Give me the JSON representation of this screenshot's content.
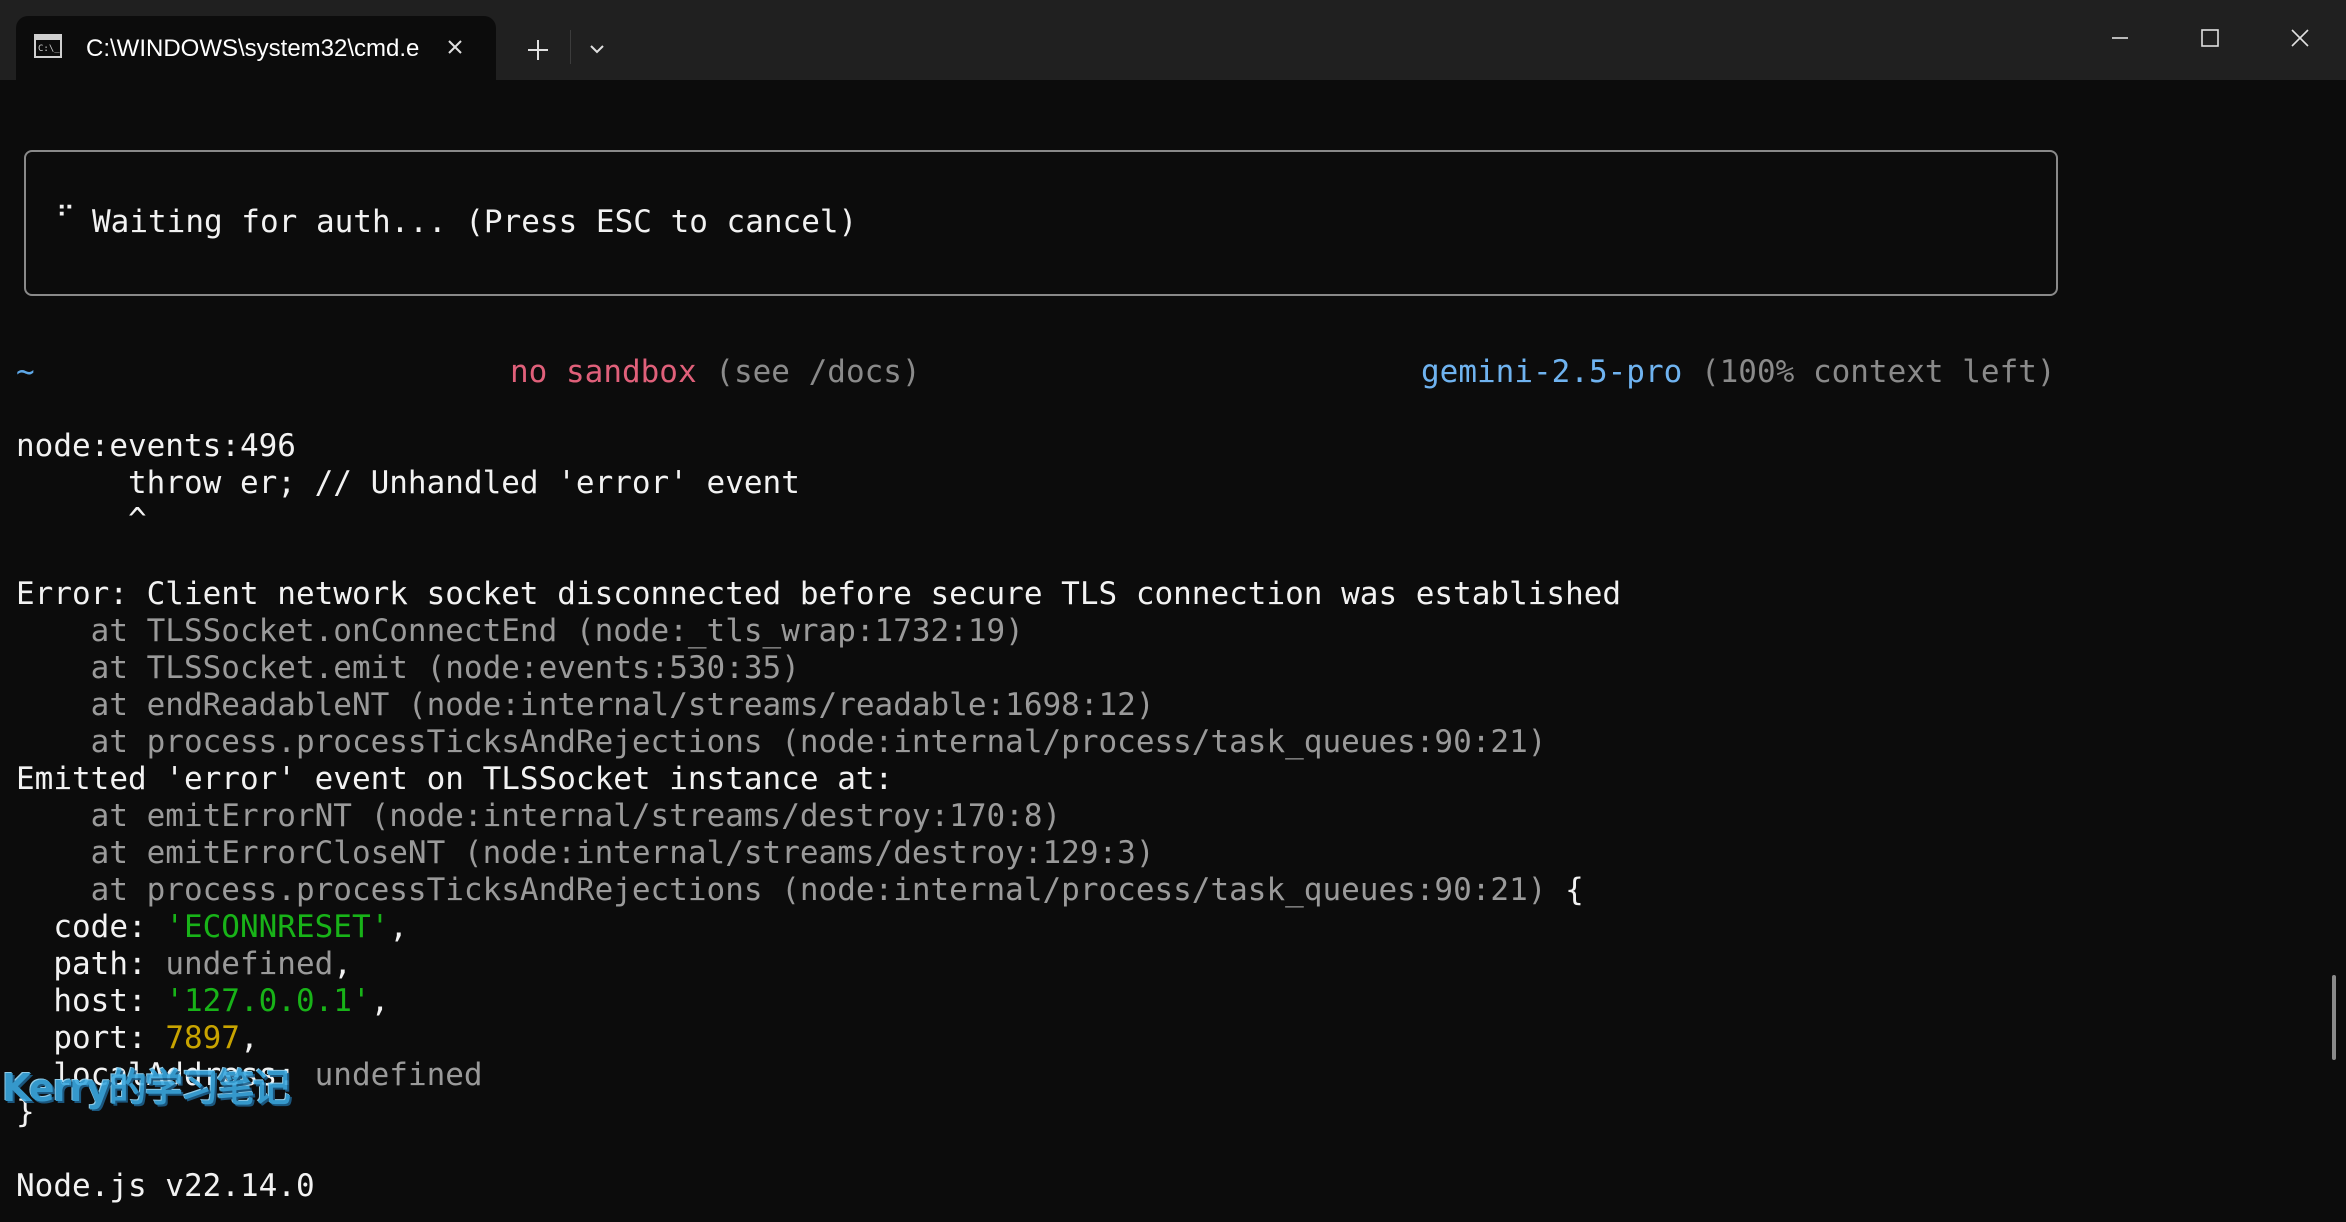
{
  "window": {
    "tab_title": "C:\\WINDOWS\\system32\\cmd.e",
    "icons": {
      "tab": "terminal-icon",
      "close_tab": "close-icon",
      "new_tab": "plus-icon",
      "tab_menu": "chevron-down-icon",
      "minimize": "minimize-icon",
      "maximize": "maximize-icon",
      "close_window": "close-icon"
    }
  },
  "auth_box": {
    "spinner": "⠋",
    "text": "Waiting for auth... (Press ESC to cancel)"
  },
  "status_bar": {
    "path": "~",
    "sandbox": "no sandbox",
    "sandbox_hint": " (see /docs)",
    "model": "gemini-2.5-pro",
    "context": " (100% context left)"
  },
  "output": {
    "l1": "node:events:496",
    "l2": "      throw er; // Unhandled 'error' event",
    "l3": "      ^",
    "l4": "Error: Client network socket disconnected before secure TLS connection was established",
    "l5": "    at TLSSocket.onConnectEnd (node:_tls_wrap:1732:19)",
    "l6": "    at TLSSocket.emit (node:events:530:35)",
    "l7": "    at endReadableNT (node:internal/streams/readable:1698:12)",
    "l8": "    at process.processTicksAndRejections (node:internal/process/task_queues:90:21)",
    "l9": "Emitted 'error' event on TLSSocket instance at:",
    "l10": "    at emitErrorNT (node:internal/streams/destroy:170:8)",
    "l11": "    at emitErrorCloseNT (node:internal/streams/destroy:129:3)",
    "l12": "    at process.processTicksAndRejections (node:internal/process/task_queues:90:21)",
    "l12_brace": " {",
    "code_key": "  code: ",
    "code_val": "'ECONNRESET'",
    "path_key": "  path: ",
    "path_val": "undefined",
    "host_key": "  host: ",
    "host_val": "'127.0.0.1'",
    "port_key": "  port: ",
    "port_val": "7897",
    "local_key": "  localAddress: ",
    "local_val": "undefined",
    "close_brace": "}",
    "comma": ",",
    "node_version": "Node.js v22.14.0"
  },
  "watermark": "Kerry的学习笔记",
  "colors": {
    "background": "#0c0c0c",
    "titlebar": "#202020",
    "foreground": "#f2f2f2",
    "dim": "#9a9a9a",
    "string": "#18b318",
    "number": "#c8a400",
    "sandbox": "#e0607a",
    "model": "#6fb3f0"
  }
}
